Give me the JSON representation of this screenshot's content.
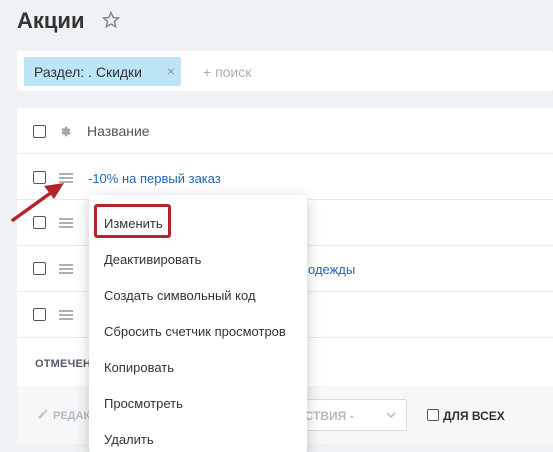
{
  "page": {
    "title": "Акции"
  },
  "filter": {
    "chip_label": "Раздел: . Скидки",
    "chip_close": "×",
    "search_placeholder": "+ поиск"
  },
  "grid": {
    "header_label": "Название",
    "rows": [
      {
        "link": "-10% на первый заказ"
      },
      {
        "link": ""
      },
      {
        "link": "одежды"
      },
      {
        "link": ""
      }
    ],
    "footer_label": "ОТМЕЧЕН"
  },
  "action_bar": {
    "edit_label": "РЕДАК",
    "actions_label": "ЕЙСТВИЯ -",
    "for_all_label": "ДЛЯ ВСЕХ"
  },
  "context_menu": {
    "items": [
      "Изменить",
      "Деактивировать",
      "Создать символьный код",
      "Сбросить счетчик просмотров",
      "Копировать",
      "Просмотреть",
      "Удалить"
    ]
  },
  "colors": {
    "highlight": "#b5242a",
    "arrow": "#b5242a",
    "link": "#2067b0",
    "chip": "#bce5f5"
  }
}
